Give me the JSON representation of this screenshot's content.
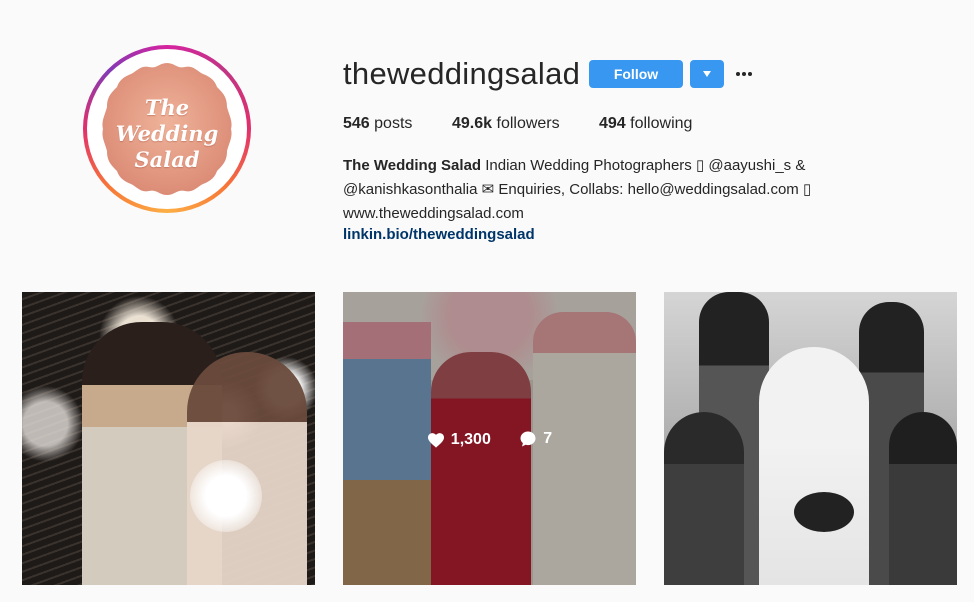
{
  "profile": {
    "username": "theweddingsalad",
    "follow_label": "Follow",
    "avatar_logo_lines": [
      "The",
      "Wedding",
      "Salad"
    ],
    "colors": {
      "accent": "#3897f0",
      "link": "#003569",
      "ring": "#c13584",
      "logo_bg": "#e59a7f"
    }
  },
  "stats": {
    "posts_count": "546",
    "posts_label": "posts",
    "followers_count": "49.6k",
    "followers_label": "followers",
    "following_count": "494",
    "following_label": "following"
  },
  "bio": {
    "name": "The Wedding Salad",
    "line1_text": "Indian Wedding Photographers ▯",
    "mention1": "@aayushi_s",
    "line1_tail": "&",
    "mention2": "@kanishkasonthalia",
    "line2_text": "✉ Enquiries, Collabs: hello@weddingsalad.com ▯",
    "line3_text": "www.theweddingsalad.com",
    "link": "linkin.bio/theweddingsalad"
  },
  "posts": [
    {
      "id": "post-1"
    },
    {
      "id": "post-2",
      "likes": "1,300",
      "comments": "7"
    },
    {
      "id": "post-3"
    }
  ],
  "icons": [
    "more-options-icon",
    "dropdown-arrow-icon",
    "heart-icon",
    "comment-icon"
  ]
}
